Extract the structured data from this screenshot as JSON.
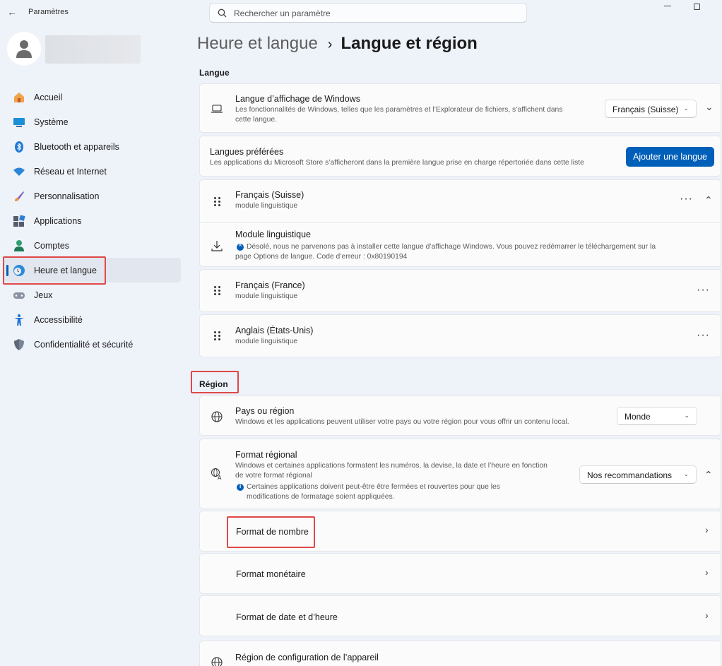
{
  "window": {
    "title": "Paramètres"
  },
  "search": {
    "placeholder": "Rechercher un paramètre"
  },
  "sidebar": {
    "items": [
      {
        "label": "Accueil"
      },
      {
        "label": "Système"
      },
      {
        "label": "Bluetooth et appareils"
      },
      {
        "label": "Réseau et Internet"
      },
      {
        "label": "Personnalisation"
      },
      {
        "label": "Applications"
      },
      {
        "label": "Comptes"
      },
      {
        "label": "Heure et langue"
      },
      {
        "label": "Jeux"
      },
      {
        "label": "Accessibilité"
      },
      {
        "label": "Confidentialité et sécurité"
      }
    ]
  },
  "breadcrumb": {
    "parent": "Heure et langue",
    "separator": "›",
    "current": "Langue et région"
  },
  "langue": {
    "section_label": "Langue",
    "display": {
      "title": "Langue d’affichage de Windows",
      "desc_line1": "Les fonctionnalités de Windows, telles que les paramètres et l’Explorateur de fichiers, s’affichent dans",
      "desc_line2": "cette langue.",
      "value": "Français (Suisse)"
    },
    "preferred": {
      "title": "Langues préférées",
      "desc": "Les applications du Microsoft Store s’afficheront dans la première langue prise en charge répertoriée dans cette liste",
      "button": "Ajouter une langue"
    },
    "languages": [
      {
        "name": "Français (Suisse)",
        "sub": "module linguistique"
      },
      {
        "name": "Français (France)",
        "sub": "module linguistique"
      },
      {
        "name": "Anglais (États-Unis)",
        "sub": "module linguistique"
      }
    ],
    "module": {
      "title": "Module linguistique",
      "error_line1": "Désolé, nous ne parvenons pas à installer cette langue d’affichage Windows. Vous pouvez redémarrer le téléchargement sur la",
      "error_line2": "page Options de langue. Code d’erreur : 0x80190194"
    }
  },
  "region": {
    "section_label": "Région",
    "country": {
      "title": "Pays ou région",
      "desc": "Windows et les applications peuvent utiliser votre pays ou votre région pour vous offrir un contenu local.",
      "value": "Monde"
    },
    "format": {
      "title": "Format régional",
      "desc_line1": "Windows et certaines applications formatent les numéros, la devise, la date et l’heure en fonction",
      "desc_line2": "de votre format régional",
      "note_line1": "Certaines applications doivent peut-être être fermées et rouvertes pour que les",
      "note_line2": "modifications de formatage soient appliquées.",
      "value": "Nos recommandations"
    },
    "sub_rows": [
      {
        "label": "Format de nombre"
      },
      {
        "label": "Format monétaire"
      },
      {
        "label": "Format de date et d’heure"
      }
    ],
    "device_region": {
      "title": "Région de configuration de l’appareil"
    }
  },
  "colors": {
    "accent": "#005fb8",
    "highlight": "#e04848"
  }
}
